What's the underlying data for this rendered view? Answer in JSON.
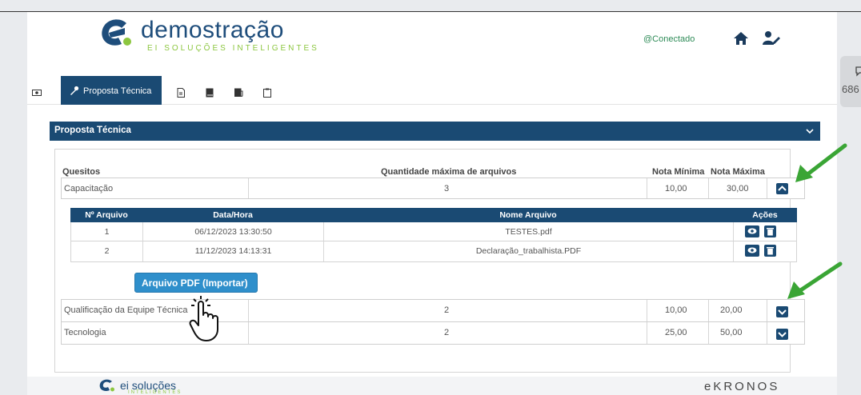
{
  "header": {
    "brand": "demostração",
    "tagline": "EI SOLUÇÕES INTELIGENTES",
    "status": "@Conectado"
  },
  "side_panel": {
    "count": "686"
  },
  "tabs": {
    "active_label": "Proposta Técnica"
  },
  "section": {
    "title": "Proposta Técnica"
  },
  "columns": {
    "quesitos": "Quesitos",
    "qtd_max": "Quantidade máxima de arquivos",
    "nota_min": "Nota Mínima",
    "nota_max": "Nota Máxima"
  },
  "rows": [
    {
      "name": "Capacitação",
      "qtd": "3",
      "min": "10,00",
      "max": "30,00"
    },
    {
      "name": "Qualificação da Equipe Técnica",
      "qtd": "2",
      "min": "10,00",
      "max": "20,00"
    },
    {
      "name": "Tecnologia",
      "qtd": "2",
      "min": "25,00",
      "max": "50,00"
    }
  ],
  "files_table": {
    "headers": {
      "num": "Nº Arquivo",
      "date": "Data/Hora",
      "name": "Nome Arquivo",
      "actions": "Ações"
    },
    "rows": [
      {
        "num": "1",
        "date": "06/12/2023 13:30:50",
        "name": "TESTES.pdf"
      },
      {
        "num": "2",
        "date": "11/12/2023 14:13:31",
        "name": "Declaração_trabalhista.PDF"
      }
    ]
  },
  "import_button": "Arquivo PDF (Importar)",
  "footer": {
    "brand": "ei soluções",
    "sub": "INTELIGENTES",
    "right_logo": "eKRONOS"
  },
  "colors": {
    "primary": "#1a4a73",
    "accent": "#8cc63f",
    "button": "#2f8fcb",
    "arrow": "#3aa535"
  }
}
